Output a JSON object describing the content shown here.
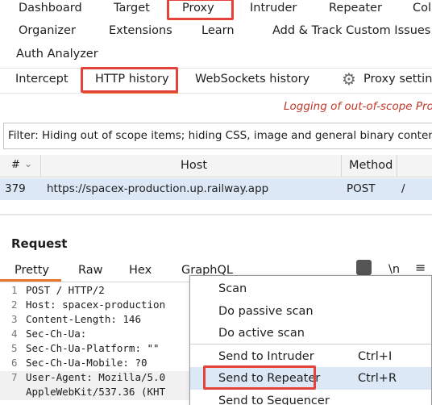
{
  "main_tabs": [
    "Dashboard",
    "Target",
    "Proxy",
    "Intruder",
    "Repeater",
    "Col"
  ],
  "main_tabs_row2": [
    "Organizer",
    "Extensions",
    "Learn",
    "Add & Track Custom Issues"
  ],
  "main_tabs_row3": [
    "Auth Analyzer"
  ],
  "proxy_tabs": [
    "Intercept",
    "HTTP history",
    "WebSockets history"
  ],
  "proxy_settings": "Proxy setting",
  "logging_message": "Logging of out-of-scope Prox",
  "filter_text": "Filter: Hiding out of scope items;  hiding CSS, image and general binary content",
  "table": {
    "headers": [
      "#",
      "Host",
      "Method"
    ],
    "rows": [
      {
        "id": "379",
        "host": "https://spacex-production.up.railway.app",
        "method": "POST",
        "extra": "/"
      }
    ]
  },
  "request": {
    "title": "Request",
    "tabs": [
      "Pretty",
      "Raw",
      "Hex",
      "GraphQL"
    ],
    "toolbar_newline": "\\n",
    "lines": [
      {
        "n": "1",
        "t": "POST / HTTP/2"
      },
      {
        "n": "2",
        "t": "Host: spacex-production"
      },
      {
        "n": "3",
        "t": "Content-Length: 146"
      },
      {
        "n": "4",
        "t": "Sec-Ch-Ua:"
      },
      {
        "n": "5",
        "t": "Sec-Ch-Ua-Platform: \"\""
      },
      {
        "n": "6",
        "t": "Sec-Ch-Ua-Mobile: ?0"
      },
      {
        "n": "7",
        "t": "User-Agent: Mozilla/5.0"
      },
      {
        "n": "",
        "t": "AppleWebKit/537.36 (KHT"
      }
    ]
  },
  "context_menu": {
    "items": [
      {
        "label": "Scan",
        "shortcut": ""
      },
      {
        "label": "Do passive scan",
        "shortcut": ""
      },
      {
        "label": "Do active scan",
        "shortcut": ""
      },
      {
        "label": "Send to Intruder",
        "shortcut": "Ctrl+I"
      },
      {
        "label": "Send to Repeater",
        "shortcut": "Ctrl+R"
      },
      {
        "label": "Send to Sequencer",
        "shortcut": ""
      }
    ]
  },
  "colors": {
    "highlight_red": "#e3433a",
    "selected_row": "#dce8f6",
    "accent_orange": "#e8762b",
    "logging_red": "#c0392b"
  }
}
